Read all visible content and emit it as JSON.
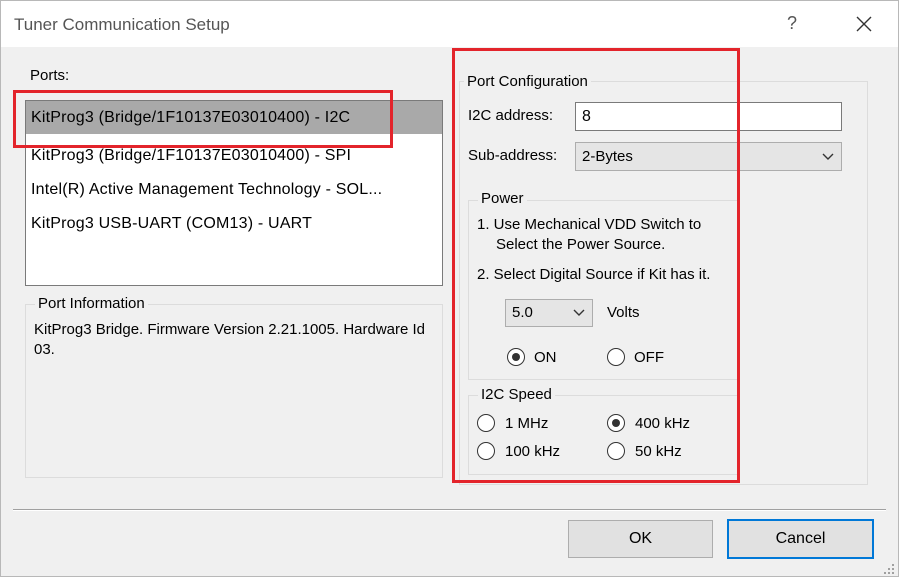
{
  "window": {
    "title": "Tuner Communication Setup",
    "help_glyph": "?"
  },
  "ports": {
    "label": "Ports:",
    "items": [
      "KitProg3 (Bridge/1F10137E03010400) - I2C",
      "KitProg3 (Bridge/1F10137E03010400) - SPI",
      "Intel(R) Active Management Technology - SOL...",
      "KitProg3 USB-UART (COM13) - UART"
    ],
    "selected_index": 0
  },
  "port_info": {
    "legend": "Port Information",
    "text": "KitProg3 Bridge. Firmware Version 2.21.1005. Hardware Id 03."
  },
  "port_config": {
    "legend": "Port Configuration",
    "i2c_address_label": "I2C address:",
    "i2c_address_value": "8",
    "sub_address_label": "Sub-address:",
    "sub_address_value": "2-Bytes"
  },
  "power": {
    "legend": "Power",
    "step1": "1. Use Mechanical VDD Switch to",
    "step1b": "Select the Power Source.",
    "step2": "2. Select Digital Source if Kit has it.",
    "voltage_value": "5.0",
    "volts_label": "Volts",
    "on_label": "ON",
    "off_label": "OFF",
    "selected": "ON"
  },
  "i2c_speed": {
    "legend": "I2C Speed",
    "options": [
      "1 MHz",
      "400 kHz",
      "100 kHz",
      "50 kHz"
    ],
    "selected": "400 kHz"
  },
  "buttons": {
    "ok": "OK",
    "cancel": "Cancel"
  },
  "colors": {
    "highlight_red": "#e3242b",
    "selection_gray": "#a9a9a9",
    "focus_blue": "#0078d7"
  },
  "icons": [
    "close-icon",
    "chevron-down-icon",
    "resize-grip-icon"
  ]
}
